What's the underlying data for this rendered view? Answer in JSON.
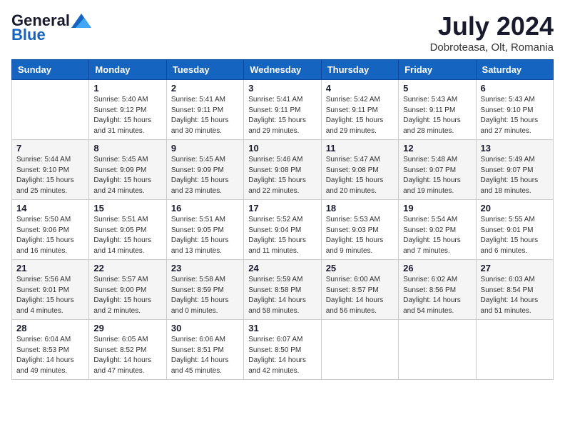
{
  "header": {
    "logo_general": "General",
    "logo_blue": "Blue",
    "month_year": "July 2024",
    "location": "Dobroteasa, Olt, Romania"
  },
  "days_of_week": [
    "Sunday",
    "Monday",
    "Tuesday",
    "Wednesday",
    "Thursday",
    "Friday",
    "Saturday"
  ],
  "weeks": [
    [
      {
        "day": "",
        "info": ""
      },
      {
        "day": "1",
        "info": "Sunrise: 5:40 AM\nSunset: 9:12 PM\nDaylight: 15 hours\nand 31 minutes."
      },
      {
        "day": "2",
        "info": "Sunrise: 5:41 AM\nSunset: 9:11 PM\nDaylight: 15 hours\nand 30 minutes."
      },
      {
        "day": "3",
        "info": "Sunrise: 5:41 AM\nSunset: 9:11 PM\nDaylight: 15 hours\nand 29 minutes."
      },
      {
        "day": "4",
        "info": "Sunrise: 5:42 AM\nSunset: 9:11 PM\nDaylight: 15 hours\nand 29 minutes."
      },
      {
        "day": "5",
        "info": "Sunrise: 5:43 AM\nSunset: 9:11 PM\nDaylight: 15 hours\nand 28 minutes."
      },
      {
        "day": "6",
        "info": "Sunrise: 5:43 AM\nSunset: 9:10 PM\nDaylight: 15 hours\nand 27 minutes."
      }
    ],
    [
      {
        "day": "7",
        "info": "Sunrise: 5:44 AM\nSunset: 9:10 PM\nDaylight: 15 hours\nand 25 minutes."
      },
      {
        "day": "8",
        "info": "Sunrise: 5:45 AM\nSunset: 9:09 PM\nDaylight: 15 hours\nand 24 minutes."
      },
      {
        "day": "9",
        "info": "Sunrise: 5:45 AM\nSunset: 9:09 PM\nDaylight: 15 hours\nand 23 minutes."
      },
      {
        "day": "10",
        "info": "Sunrise: 5:46 AM\nSunset: 9:08 PM\nDaylight: 15 hours\nand 22 minutes."
      },
      {
        "day": "11",
        "info": "Sunrise: 5:47 AM\nSunset: 9:08 PM\nDaylight: 15 hours\nand 20 minutes."
      },
      {
        "day": "12",
        "info": "Sunrise: 5:48 AM\nSunset: 9:07 PM\nDaylight: 15 hours\nand 19 minutes."
      },
      {
        "day": "13",
        "info": "Sunrise: 5:49 AM\nSunset: 9:07 PM\nDaylight: 15 hours\nand 18 minutes."
      }
    ],
    [
      {
        "day": "14",
        "info": "Sunrise: 5:50 AM\nSunset: 9:06 PM\nDaylight: 15 hours\nand 16 minutes."
      },
      {
        "day": "15",
        "info": "Sunrise: 5:51 AM\nSunset: 9:05 PM\nDaylight: 15 hours\nand 14 minutes."
      },
      {
        "day": "16",
        "info": "Sunrise: 5:51 AM\nSunset: 9:05 PM\nDaylight: 15 hours\nand 13 minutes."
      },
      {
        "day": "17",
        "info": "Sunrise: 5:52 AM\nSunset: 9:04 PM\nDaylight: 15 hours\nand 11 minutes."
      },
      {
        "day": "18",
        "info": "Sunrise: 5:53 AM\nSunset: 9:03 PM\nDaylight: 15 hours\nand 9 minutes."
      },
      {
        "day": "19",
        "info": "Sunrise: 5:54 AM\nSunset: 9:02 PM\nDaylight: 15 hours\nand 7 minutes."
      },
      {
        "day": "20",
        "info": "Sunrise: 5:55 AM\nSunset: 9:01 PM\nDaylight: 15 hours\nand 6 minutes."
      }
    ],
    [
      {
        "day": "21",
        "info": "Sunrise: 5:56 AM\nSunset: 9:01 PM\nDaylight: 15 hours\nand 4 minutes."
      },
      {
        "day": "22",
        "info": "Sunrise: 5:57 AM\nSunset: 9:00 PM\nDaylight: 15 hours\nand 2 minutes."
      },
      {
        "day": "23",
        "info": "Sunrise: 5:58 AM\nSunset: 8:59 PM\nDaylight: 15 hours\nand 0 minutes."
      },
      {
        "day": "24",
        "info": "Sunrise: 5:59 AM\nSunset: 8:58 PM\nDaylight: 14 hours\nand 58 minutes."
      },
      {
        "day": "25",
        "info": "Sunrise: 6:00 AM\nSunset: 8:57 PM\nDaylight: 14 hours\nand 56 minutes."
      },
      {
        "day": "26",
        "info": "Sunrise: 6:02 AM\nSunset: 8:56 PM\nDaylight: 14 hours\nand 54 minutes."
      },
      {
        "day": "27",
        "info": "Sunrise: 6:03 AM\nSunset: 8:54 PM\nDaylight: 14 hours\nand 51 minutes."
      }
    ],
    [
      {
        "day": "28",
        "info": "Sunrise: 6:04 AM\nSunset: 8:53 PM\nDaylight: 14 hours\nand 49 minutes."
      },
      {
        "day": "29",
        "info": "Sunrise: 6:05 AM\nSunset: 8:52 PM\nDaylight: 14 hours\nand 47 minutes."
      },
      {
        "day": "30",
        "info": "Sunrise: 6:06 AM\nSunset: 8:51 PM\nDaylight: 14 hours\nand 45 minutes."
      },
      {
        "day": "31",
        "info": "Sunrise: 6:07 AM\nSunset: 8:50 PM\nDaylight: 14 hours\nand 42 minutes."
      },
      {
        "day": "",
        "info": ""
      },
      {
        "day": "",
        "info": ""
      },
      {
        "day": "",
        "info": ""
      }
    ]
  ]
}
